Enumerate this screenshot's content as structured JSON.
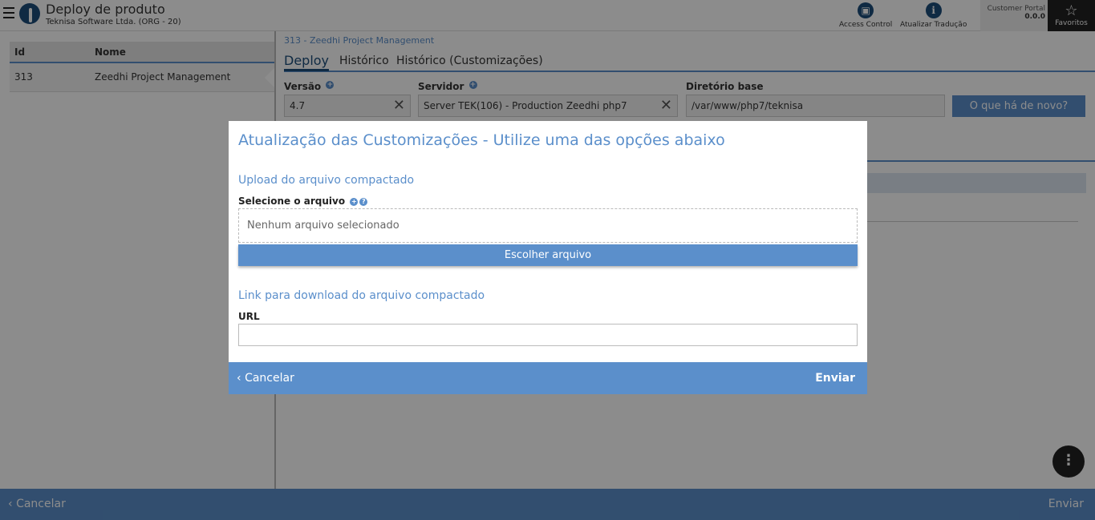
{
  "header": {
    "title": "Deploy de produto",
    "subtitle": "Teknisa Software Ltda. (ORG - 20)",
    "access_control": "Access Control",
    "update_translation": "Atualizar Tradução",
    "portal_label": "Customer Portal",
    "portal_version": "0.0.0",
    "favorites": "Favoritos"
  },
  "grid": {
    "columns": [
      "Id",
      "Nome"
    ],
    "rows": [
      {
        "id": "313",
        "nome": "Zeedhi Project Management"
      }
    ]
  },
  "detail": {
    "breadcrumb": "313 - Zeedhi Project Management",
    "tabs": [
      "Deploy",
      "Histórico",
      "Histórico (Customizações)"
    ],
    "version_label": "Versão",
    "version_value": "4.7",
    "server_label": "Servidor",
    "server_value": "Server TEK(106) - Production Zeedhi php7",
    "basedir_label": "Diretório base",
    "basedir_value": "/var/www/php7/teknisa",
    "news_button": "O que há de novo?"
  },
  "footer": {
    "cancel": "Cancelar",
    "send": "Enviar"
  },
  "modal": {
    "title": "Atualização das Customizações - Utilize uma das opções abaixo",
    "upload_section": "Upload do arquivo compactado",
    "file_label": "Selecione o arquivo",
    "file_placeholder": "Nenhum arquivo selecionado",
    "choose_button": "Escolher arquivo",
    "link_section": "Link para download do arquivo compactado",
    "url_label": "URL",
    "url_value": "",
    "cancel": "Cancelar",
    "send": "Enviar"
  },
  "colors": {
    "accent": "#5b8fcb",
    "dark": "#1d4d7a"
  }
}
